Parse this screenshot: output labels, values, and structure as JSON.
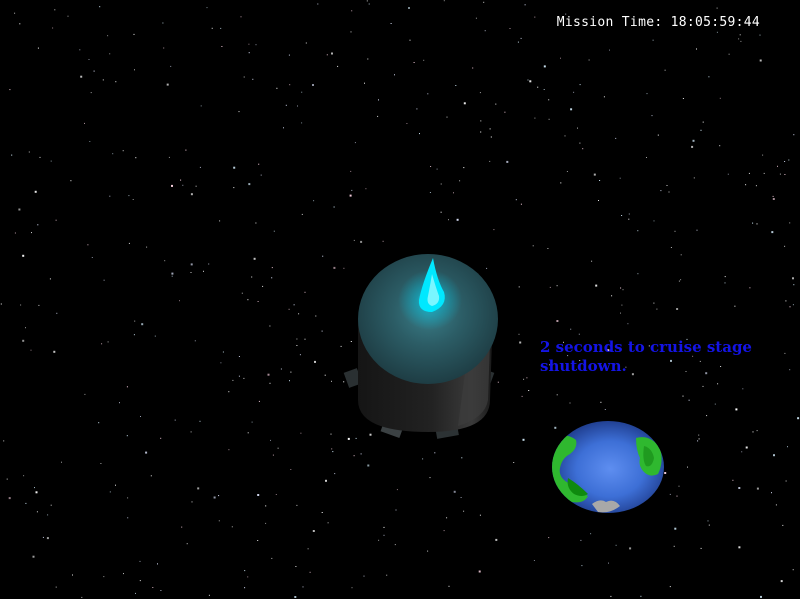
{
  "hud": {
    "mission_time_label": "Mission Time:",
    "mission_time_value": "18:05:59:44"
  },
  "message": {
    "text": "2 seconds to cruise stage shutdown."
  },
  "scene": {
    "objects": [
      "spacecraft-cruise-stage",
      "earth-globe",
      "starfield"
    ]
  },
  "colors": {
    "background": "#000000",
    "hud_text": "#ffffff",
    "message_text": "#1414e6",
    "thruster_flame": "#00e5ff",
    "earth_ocean": "#3d6fd6",
    "earth_land": "#2fb82f"
  }
}
